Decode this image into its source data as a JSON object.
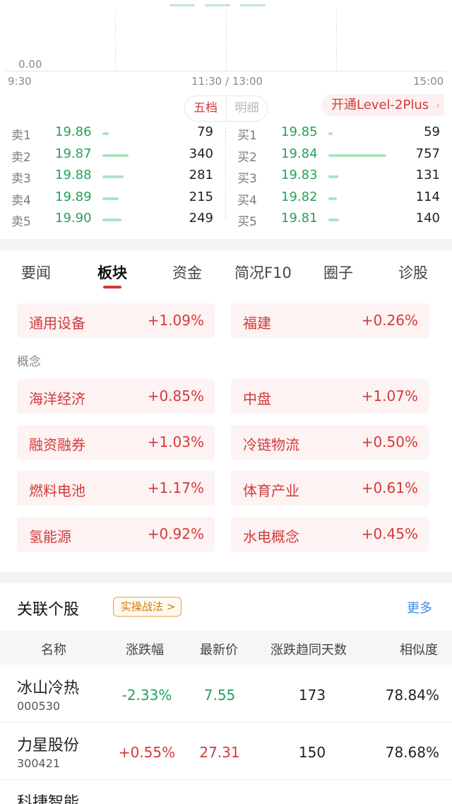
{
  "chart": {
    "y_label": "0.00",
    "x_ticks": [
      "9:30",
      "11:30 / 13:00",
      "15:00"
    ]
  },
  "orderbook": {
    "tabs": [
      "五档",
      "明细"
    ],
    "level2": "开通Level-2Plus",
    "level2_icon": "chevron-right-icon",
    "sell": [
      {
        "label": "卖1",
        "price": "19.86",
        "volume": "79",
        "volume_value": 79
      },
      {
        "label": "卖2",
        "price": "19.87",
        "volume": "340",
        "volume_value": 340
      },
      {
        "label": "卖3",
        "price": "19.88",
        "volume": "281",
        "volume_value": 281
      },
      {
        "label": "卖4",
        "price": "19.89",
        "volume": "215",
        "volume_value": 215
      },
      {
        "label": "卖5",
        "price": "19.90",
        "volume": "249",
        "volume_value": 249
      }
    ],
    "buy": [
      {
        "label": "买1",
        "price": "19.85",
        "volume": "59",
        "volume_value": 59
      },
      {
        "label": "买2",
        "price": "19.84",
        "volume": "757",
        "volume_value": 757
      },
      {
        "label": "买3",
        "price": "19.83",
        "volume": "131",
        "volume_value": 131
      },
      {
        "label": "买4",
        "price": "19.82",
        "volume": "114",
        "volume_value": 114
      },
      {
        "label": "买5",
        "price": "19.81",
        "volume": "140",
        "volume_value": 140
      }
    ],
    "max_volume": 757
  },
  "tabs": [
    "要闻",
    "板块",
    "资金",
    "简况F10",
    "圈子",
    "诊股"
  ],
  "active_tab": "板块",
  "industry": [
    {
      "name": "通用设备",
      "pct": "+1.09%"
    },
    {
      "name": "福建",
      "pct": "+0.26%"
    }
  ],
  "concept_label": "概念",
  "concepts": [
    {
      "name": "海洋经济",
      "pct": "+0.85%"
    },
    {
      "name": "中盘",
      "pct": "+1.07%"
    },
    {
      "name": "融资融券",
      "pct": "+1.03%"
    },
    {
      "name": "冷链物流",
      "pct": "+0.50%"
    },
    {
      "name": "燃料电池",
      "pct": "+1.17%"
    },
    {
      "name": "体育产业",
      "pct": "+0.61%"
    },
    {
      "name": "氢能源",
      "pct": "+0.92%"
    },
    {
      "name": "水电概念",
      "pct": "+0.45%"
    }
  ],
  "related": {
    "title": "关联个股",
    "strategy": "实操战法 >",
    "more": "更多",
    "headers": [
      "名称",
      "涨跌幅",
      "最新价",
      "涨跌趋同天数",
      "相似度"
    ],
    "rows": [
      {
        "name": "冰山冷热",
        "code": "000530",
        "change": "-2.33%",
        "last": "7.55",
        "days": "173",
        "similarity": "78.84%",
        "dir": "down"
      },
      {
        "name": "力星股份",
        "code": "300421",
        "change": "+0.55%",
        "last": "27.31",
        "days": "150",
        "similarity": "78.68%",
        "dir": "up"
      },
      {
        "name": "科捷智能",
        "code": "",
        "change": "",
        "last": "",
        "days": "",
        "similarity": "",
        "dir": "up"
      }
    ]
  },
  "colors": {
    "up": "#d33a3a",
    "down": "#25a15a",
    "accent": "#3a8ee6",
    "strategy": "#d07a10"
  }
}
